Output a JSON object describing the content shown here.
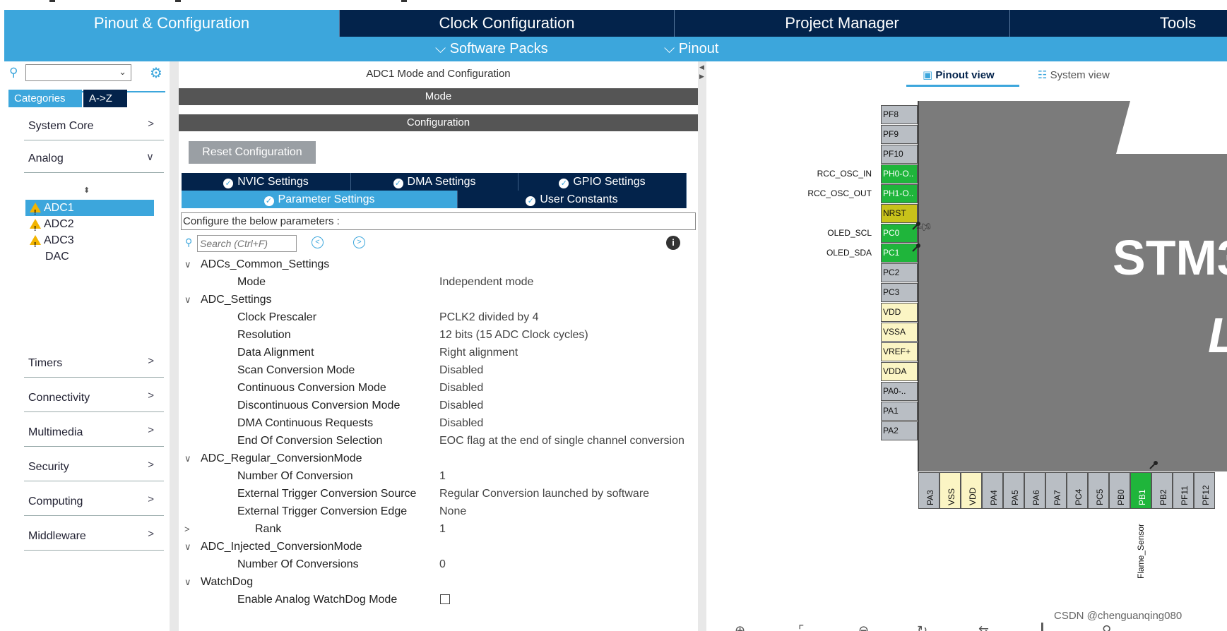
{
  "tabs": [
    "Pinout & Configuration",
    "Clock Configuration",
    "Project Manager",
    "Tools"
  ],
  "subbar": {
    "software_packs": "Software Packs",
    "pinout": "Pinout"
  },
  "left": {
    "cat_tab": "Categories",
    "az_tab": "A->Z",
    "categories": [
      "System Core",
      "Analog",
      "Timers",
      "Connectivity",
      "Multimedia",
      "Security",
      "Computing",
      "Middleware"
    ],
    "analog_items": [
      "ADC1",
      "ADC2",
      "ADC3",
      "DAC"
    ]
  },
  "middle": {
    "title": "ADC1 Mode and Configuration",
    "mode_header": "Mode",
    "config_header": "Configuration",
    "reset_button": "Reset Configuration",
    "tabs_row1": [
      "NVIC Settings",
      "DMA Settings",
      "GPIO Settings"
    ],
    "tabs_row2": [
      "Parameter Settings",
      "User Constants"
    ],
    "configure_label": "Configure the below parameters :",
    "search_placeholder": "Search (Ctrl+F)",
    "params": [
      {
        "name": "ADCs_Common_Settings",
        "value": "",
        "group": true
      },
      {
        "name": "Mode",
        "value": "Independent mode"
      },
      {
        "name": "ADC_Settings",
        "value": "",
        "group": true
      },
      {
        "name": "Clock Prescaler",
        "value": "PCLK2 divided by 4"
      },
      {
        "name": "Resolution",
        "value": "12 bits (15 ADC Clock cycles)"
      },
      {
        "name": "Data Alignment",
        "value": "Right alignment"
      },
      {
        "name": "Scan Conversion Mode",
        "value": "Disabled"
      },
      {
        "name": "Continuous Conversion Mode",
        "value": "Disabled"
      },
      {
        "name": "Discontinuous Conversion Mode",
        "value": "Disabled"
      },
      {
        "name": "DMA Continuous Requests",
        "value": "Disabled"
      },
      {
        "name": "End Of Conversion Selection",
        "value": "EOC flag at the end of single channel conversion"
      },
      {
        "name": "ADC_Regular_ConversionMode",
        "value": "",
        "group": true
      },
      {
        "name": "Number Of Conversion",
        "value": "1"
      },
      {
        "name": "External Trigger Conversion Source",
        "value": "Regular Conversion launched by software"
      },
      {
        "name": "External Trigger Conversion Edge",
        "value": "None"
      },
      {
        "name": "Rank",
        "value": "1",
        "collapsed": true
      },
      {
        "name": "ADC_Injected_ConversionMode",
        "value": "",
        "group": true
      },
      {
        "name": "Number Of Conversions",
        "value": "0"
      },
      {
        "name": "WatchDog",
        "value": "",
        "group": true
      },
      {
        "name": "Enable Analog WatchDog Mode",
        "value": "",
        "checkbox": true
      }
    ]
  },
  "right": {
    "pinout_view": "Pinout view",
    "system_view": "System view",
    "chip_text": "STM3",
    "chip_text2": "L",
    "left_pins": [
      {
        "name": "PF8",
        "label": "",
        "state": "gray"
      },
      {
        "name": "PF9",
        "label": "",
        "state": "gray"
      },
      {
        "name": "PF10",
        "label": "",
        "state": "gray"
      },
      {
        "name": "PH0-O..",
        "label": "RCC_OSC_IN",
        "state": "green"
      },
      {
        "name": "PH1-O..",
        "label": "RCC_OSC_OUT",
        "state": "green"
      },
      {
        "name": "NRST",
        "label": "",
        "state": "yellow"
      },
      {
        "name": "PC0",
        "label": "OLED_SCL",
        "state": "green"
      },
      {
        "name": "PC1",
        "label": "OLED_SDA",
        "state": "green"
      },
      {
        "name": "PC2",
        "label": "",
        "state": "gray"
      },
      {
        "name": "PC3",
        "label": "",
        "state": "gray"
      },
      {
        "name": "VDD",
        "label": "",
        "state": "cream"
      },
      {
        "name": "VSSA",
        "label": "",
        "state": "cream"
      },
      {
        "name": "VREF+",
        "label": "",
        "state": "cream"
      },
      {
        "name": "VDDA",
        "label": "",
        "state": "cream"
      },
      {
        "name": "PA0-..",
        "label": "",
        "state": "gray"
      },
      {
        "name": "PA1",
        "label": "",
        "state": "gray"
      },
      {
        "name": "PA2",
        "label": "",
        "state": "gray"
      }
    ],
    "bottom_pins": [
      {
        "name": "PA3",
        "state": "gray"
      },
      {
        "name": "VSS",
        "state": "cream"
      },
      {
        "name": "VDD",
        "state": "cream"
      },
      {
        "name": "PA4",
        "state": "gray"
      },
      {
        "name": "PA5",
        "state": "gray"
      },
      {
        "name": "PA6",
        "state": "gray"
      },
      {
        "name": "PA7",
        "state": "gray"
      },
      {
        "name": "PC4",
        "state": "gray"
      },
      {
        "name": "PC5",
        "state": "gray"
      },
      {
        "name": "PB0",
        "state": "gray"
      },
      {
        "name": "PB1",
        "state": "green"
      },
      {
        "name": "PB2",
        "state": "gray"
      },
      {
        "name": "PF11",
        "state": "gray"
      },
      {
        "name": "PF12",
        "state": "gray"
      }
    ],
    "flame_label": "Flame_Sensor",
    "watermark": "CSDN @chenguanqing080"
  },
  "colors": {
    "nav_dark": "#03234b",
    "accent": "#3ca6dc",
    "pin_green": "#1fb53b"
  }
}
